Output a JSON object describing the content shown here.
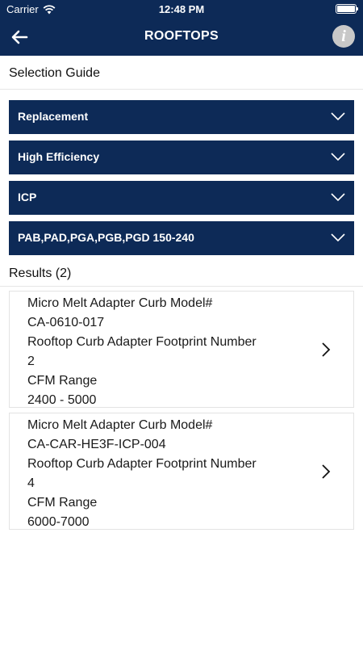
{
  "status_bar": {
    "carrier": "Carrier",
    "time": "12:48 PM"
  },
  "nav": {
    "title": "ROOFTOPS",
    "info_glyph": "i"
  },
  "selection_guide": {
    "label": "Selection Guide",
    "dropdowns": [
      {
        "label": "Replacement"
      },
      {
        "label": "High Efficiency"
      },
      {
        "label": "ICP"
      },
      {
        "label": "PAB,PAD,PGA,PGB,PGD 150-240"
      }
    ]
  },
  "results": {
    "label": "Results (2)",
    "items": [
      {
        "model_label": "Micro Melt Adapter Curb Model#",
        "model_value": "CA-0610-017",
        "footprint_label": "Rooftop Curb Adapter Footprint Number",
        "footprint_value": "2",
        "cfm_label": "CFM Range",
        "cfm_value": "2400 - 5000"
      },
      {
        "model_label": "Micro Melt Adapter Curb Model#",
        "model_value": "CA-CAR-HE3F-ICP-004",
        "footprint_label": "Rooftop Curb Adapter Footprint Number",
        "footprint_value": "4",
        "cfm_label": "CFM Range",
        "cfm_value": "6000-7000"
      }
    ]
  },
  "colors": {
    "navy": "#0d2a57",
    "info_button": "#c8c8c8"
  },
  "icons": [
    "back-arrow-icon",
    "info-icon",
    "chevron-down-icon",
    "chevron-right-icon",
    "wifi-icon",
    "battery-icon"
  ]
}
